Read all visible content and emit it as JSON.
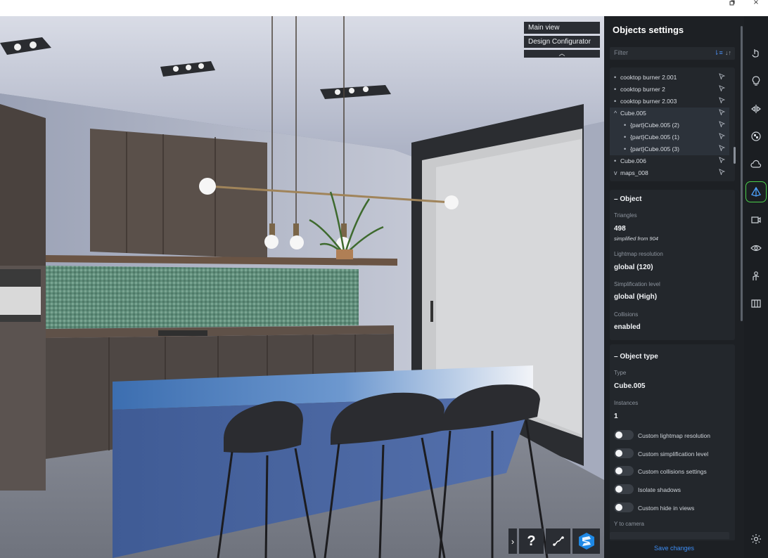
{
  "window": {
    "restore_icon": "restore-icon",
    "close_label": "×"
  },
  "viewport": {
    "views": [
      "Main view",
      "Design Configurator"
    ],
    "collapse_label": "︿",
    "toolbar": {
      "expand_label": "›",
      "help_label": "?"
    }
  },
  "panel": {
    "title": "Objects settings",
    "filter_placeholder": "Filter",
    "tree": [
      {
        "label": "cooktop burner 2.001",
        "level": 0,
        "kind": "bullet",
        "selected": false
      },
      {
        "label": "cooktop burner 2",
        "level": 0,
        "kind": "bullet",
        "selected": false
      },
      {
        "label": "cooktop burner 2.003",
        "level": 0,
        "kind": "bullet",
        "selected": false
      },
      {
        "label": "Cube.005",
        "level": 0,
        "kind": "expanded",
        "selected": true
      },
      {
        "label": "{part}Cube.005 (2)",
        "level": 1,
        "kind": "bullet",
        "selected": true
      },
      {
        "label": "{part}Cube.005 (1)",
        "level": 1,
        "kind": "bullet",
        "selected": true
      },
      {
        "label": "{part}Cube.005 (3)",
        "level": 1,
        "kind": "bullet",
        "selected": true
      },
      {
        "label": "Cube.006",
        "level": 0,
        "kind": "bullet",
        "selected": false
      },
      {
        "label": "maps_008",
        "level": 0,
        "kind": "collapsed",
        "selected": false
      }
    ],
    "object": {
      "header": "–  Object",
      "triangles_label": "Triangles",
      "triangles_value": "498",
      "triangles_note": "simplified from 904",
      "lightmap_label": "Lightmap resolution",
      "lightmap_value": "global (120)",
      "simplification_label": "Simplification level",
      "simplification_value": "global (High)",
      "collisions_label": "Collisions",
      "collisions_value": "enabled"
    },
    "object_type": {
      "header": "–  Object type",
      "type_label": "Type",
      "type_value": "Cube.005",
      "instances_label": "Instances",
      "instances_value": "1",
      "toggles": [
        {
          "label": "Custom lightmap resolution",
          "on": false
        },
        {
          "label": "Custom simplification level",
          "on": false
        },
        {
          "label": "Custom collisions settings",
          "on": false
        },
        {
          "label": "Isolate shadows",
          "on": false
        },
        {
          "label": "Custom hide in views",
          "on": false
        }
      ],
      "y_to_camera_label": "Y to camera"
    },
    "save_label": "Save changes"
  },
  "rail": {
    "items": [
      "pointer-icon",
      "bulb-icon",
      "mirror-icon",
      "material-ball-icon",
      "cloud-icon",
      "object-icon",
      "camera-icon",
      "eye-icon",
      "figure-icon",
      "map-icon",
      "settings-icon"
    ],
    "active": "object-icon",
    "accent": "#4bd04b"
  },
  "colors": {
    "panel_bg": "#1d2024",
    "accent_blue": "#3d8df5"
  }
}
